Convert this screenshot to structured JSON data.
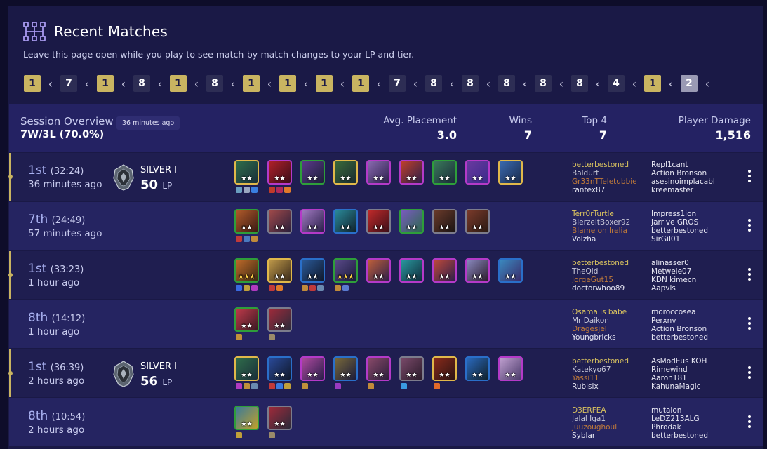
{
  "header": {
    "title": "Recent Matches",
    "subtitle": "Leave this page open while you play to see match-by-match changes to your LP and tier.",
    "icon": "hierarchy-icon"
  },
  "placement_strip": {
    "arrow": "‹",
    "items": [
      {
        "value": "1",
        "style": "gold"
      },
      {
        "value": "7",
        "style": "dark"
      },
      {
        "value": "1",
        "style": "gold"
      },
      {
        "value": "8",
        "style": "dark"
      },
      {
        "value": "1",
        "style": "gold"
      },
      {
        "value": "8",
        "style": "dark"
      },
      {
        "value": "1",
        "style": "gold"
      },
      {
        "value": "1",
        "style": "gold"
      },
      {
        "value": "1",
        "style": "gold"
      },
      {
        "value": "1",
        "style": "gold"
      },
      {
        "value": "7",
        "style": "dark"
      },
      {
        "value": "8",
        "style": "dark"
      },
      {
        "value": "8",
        "style": "dark"
      },
      {
        "value": "8",
        "style": "dark"
      },
      {
        "value": "8",
        "style": "dark"
      },
      {
        "value": "8",
        "style": "dark"
      },
      {
        "value": "4",
        "style": "dark"
      },
      {
        "value": "1",
        "style": "gold"
      },
      {
        "value": "2",
        "style": "grey"
      }
    ]
  },
  "session": {
    "label": "Session Overview",
    "ago": "36 minutes ago",
    "record": "7W/3L (70.0%)",
    "stats": {
      "avg_label": "Avg. Placement",
      "avg_value": "3.0",
      "wins_label": "Wins",
      "wins_value": "7",
      "top4_label": "Top 4",
      "top4_value": "7",
      "damage_label": "Player Damage",
      "damage_value": "1,516"
    }
  },
  "colors": {
    "win_accent": "#c9b461",
    "background": "#0e0d2a",
    "panel": "#1a1946",
    "session_panel": "#242263",
    "cost_1": "#7c7c8c",
    "cost_2": "#2e9e3a",
    "cost_3": "#2a6fc9",
    "cost_4": "#b43ac8",
    "cost_5": "#e0b84a"
  },
  "matches": [
    {
      "win": true,
      "place": "1st",
      "duration": "(32:24)",
      "ago": "36 minutes ago",
      "rank": {
        "tier": "SILVER I",
        "lp": "50",
        "lp_unit": "LP"
      },
      "units": [
        {
          "cost": 5,
          "stars": "★★",
          "gold": false,
          "colors": [
            "#2f6d4a",
            "#1a2f3a"
          ],
          "items": [
            "#6a9ec0",
            "#9aa7c0",
            "#3a7fe0"
          ]
        },
        {
          "cost": 4,
          "stars": "★★",
          "gold": false,
          "colors": [
            "#b0202a",
            "#3a0e18"
          ],
          "items": [
            "#c03a2a",
            "#b02a5a",
            "#e07a2a"
          ]
        },
        {
          "cost": 2,
          "stars": "★★",
          "gold": false,
          "colors": [
            "#5a3a8a",
            "#1e1e3a"
          ],
          "items": []
        },
        {
          "cost": 5,
          "stars": "★★",
          "gold": false,
          "colors": [
            "#3a6a3a",
            "#1a2a30"
          ],
          "items": []
        },
        {
          "cost": 4,
          "stars": "★★",
          "gold": false,
          "colors": [
            "#8a6ab0",
            "#2a1e4a"
          ],
          "items": []
        },
        {
          "cost": 4,
          "stars": "★★",
          "gold": false,
          "colors": [
            "#c0402a",
            "#2a1e4a"
          ],
          "items": []
        },
        {
          "cost": 2,
          "stars": "★★",
          "gold": false,
          "colors": [
            "#3a7a5a",
            "#1a2a3a"
          ],
          "items": []
        },
        {
          "cost": 4,
          "stars": "★★",
          "gold": false,
          "colors": [
            "#6a3aa0",
            "#3a2a8a"
          ],
          "items": []
        },
        {
          "cost": 5,
          "stars": "★★",
          "gold": false,
          "colors": [
            "#3a6ab0",
            "#1a2a4a"
          ],
          "items": []
        }
      ],
      "names_left": [
        {
          "name": "betterbestoned",
          "color": "gold"
        },
        {
          "name": "Baldurt",
          "color": "grey"
        },
        {
          "name": "Gr33nTTeletubbie",
          "color": "orange"
        },
        {
          "name": "rantex87",
          "color": "white"
        }
      ],
      "names_right": [
        "Repl1cant",
        "Action Bronson",
        "asesinoimplacabl",
        "kreemaster"
      ]
    },
    {
      "win": false,
      "place": "7th",
      "duration": "(24:49)",
      "ago": "57 minutes ago",
      "units": [
        {
          "cost": 2,
          "stars": "★★",
          "gold": false,
          "colors": [
            "#b05a2a",
            "#3a1a14"
          ],
          "items": [
            "#c03a3a",
            "#4a7ac0",
            "#c08a3a"
          ]
        },
        {
          "cost": 1,
          "stars": "★★",
          "gold": false,
          "colors": [
            "#a04a4a",
            "#2a1e3a"
          ],
          "items": []
        },
        {
          "cost": 4,
          "stars": "★★",
          "gold": false,
          "colors": [
            "#a07ac0",
            "#2a1e4a"
          ],
          "items": []
        },
        {
          "cost": 3,
          "stars": "★★",
          "gold": false,
          "colors": [
            "#2a8a9a",
            "#10202a"
          ],
          "items": []
        },
        {
          "cost": 1,
          "stars": "★★",
          "gold": false,
          "colors": [
            "#c02a2a",
            "#3a0e18"
          ],
          "items": []
        },
        {
          "cost": 2,
          "stars": "★★",
          "gold": false,
          "colors": [
            "#7a5ac0",
            "#2a6a4a"
          ],
          "items": []
        },
        {
          "cost": 1,
          "stars": "★★",
          "gold": false,
          "colors": [
            "#6a3a2a",
            "#1a1414"
          ],
          "items": []
        },
        {
          "cost": 1,
          "stars": "★★",
          "gold": false,
          "colors": [
            "#7a3a2a",
            "#2a1a14"
          ],
          "items": []
        }
      ],
      "names_left": [
        {
          "name": "Terr0rTurtle",
          "color": "gold"
        },
        {
          "name": "BierzeltBoxer92",
          "color": "grey"
        },
        {
          "name": "Blame on Irelia",
          "color": "orange"
        },
        {
          "name": "Volzha",
          "color": "white"
        }
      ],
      "names_right": [
        "Impress1ion",
        "Jarrive GROS",
        "betterbestoned",
        "SirGil01"
      ]
    },
    {
      "win": true,
      "place": "1st",
      "duration": "(33:23)",
      "ago": "1 hour ago",
      "units": [
        {
          "cost": 2,
          "stars": "★★★",
          "gold": true,
          "colors": [
            "#c06a2a",
            "#3a2a14"
          ],
          "items": [
            "#3a6ae0",
            "#c0a03a",
            "#b03ac0"
          ]
        },
        {
          "cost": 5,
          "stars": "★★",
          "gold": false,
          "colors": [
            "#c09a4a",
            "#3a2a1a"
          ],
          "items": [
            "#c03a3a",
            "#e07a2a"
          ]
        },
        {
          "cost": 3,
          "stars": "★★",
          "gold": false,
          "colors": [
            "#2a5a9a",
            "#10182a"
          ],
          "items": [
            "#c08a3a",
            "#c03a3a",
            "#6a8ab0"
          ]
        },
        {
          "cost": 2,
          "stars": "★★★",
          "gold": true,
          "colors": [
            "#5a4a8a",
            "#1a1a3a"
          ],
          "items": [
            "#c08a3a",
            "#5a7ad0"
          ]
        },
        {
          "cost": 4,
          "stars": "★★",
          "gold": false,
          "colors": [
            "#c0603a",
            "#2a1e4a"
          ],
          "items": []
        },
        {
          "cost": 4,
          "stars": "★★",
          "gold": false,
          "colors": [
            "#2a9aa0",
            "#102a3a"
          ],
          "items": []
        },
        {
          "cost": 4,
          "stars": "★★",
          "gold": false,
          "colors": [
            "#c04a3a",
            "#2a1e4a"
          ],
          "items": []
        },
        {
          "cost": 4,
          "stars": "★★",
          "gold": false,
          "colors": [
            "#8a8ac0",
            "#2a1a2a"
          ],
          "items": []
        },
        {
          "cost": 3,
          "stars": "★★",
          "gold": false,
          "colors": [
            "#3a8ac0",
            "#3a2a6a"
          ],
          "items": []
        }
      ],
      "names_left": [
        {
          "name": "betterbestoned",
          "color": "gold"
        },
        {
          "name": "TheQid",
          "color": "grey"
        },
        {
          "name": "JorgeGut15",
          "color": "orange"
        },
        {
          "name": "doctorwhoo89",
          "color": "white"
        }
      ],
      "names_right": [
        "alinasser0",
        "Metwele07",
        "KDN kimecn",
        "Aapvis"
      ]
    },
    {
      "win": false,
      "place": "8th",
      "duration": "(14:12)",
      "ago": "1 hour ago",
      "units": [
        {
          "cost": 2,
          "stars": "★★",
          "gold": false,
          "colors": [
            "#c03a4a",
            "#3a1a24"
          ],
          "items": [
            "#c0903a"
          ]
        },
        {
          "cost": 1,
          "stars": "★★",
          "gold": false,
          "colors": [
            "#a02a3a",
            "#2a2a3a"
          ],
          "items": [
            "#9a8a6a"
          ]
        }
      ],
      "names_left": [
        {
          "name": "Osama is babe",
          "color": "gold"
        },
        {
          "name": "Mr Daikon",
          "color": "grey"
        },
        {
          "name": "Dragesjel",
          "color": "orange"
        },
        {
          "name": "Youngbricks",
          "color": "white"
        }
      ],
      "names_right": [
        "moroccosea",
        "Perxnv",
        "Action Bronson",
        "betterbestoned"
      ]
    },
    {
      "win": true,
      "place": "1st",
      "duration": "(36:39)",
      "ago": "2 hours ago",
      "rank": {
        "tier": "SILVER I",
        "lp": "56",
        "lp_unit": "LP"
      },
      "units": [
        {
          "cost": 5,
          "stars": "★★",
          "gold": false,
          "colors": [
            "#2f6d4a",
            "#1a2f3a"
          ],
          "items": [
            "#b03ac0",
            "#c0903a",
            "#6a8ab0"
          ]
        },
        {
          "cost": 3,
          "stars": "★★",
          "gold": false,
          "colors": [
            "#2a4a9a",
            "#10182a"
          ],
          "items": [
            "#c03a3a",
            "#3a7ae0",
            "#c0a03a"
          ]
        },
        {
          "cost": 4,
          "stars": "★★",
          "gold": false,
          "colors": [
            "#b04aa0",
            "#2a1e4a"
          ],
          "items": [
            "#c0903a"
          ]
        },
        {
          "cost": 3,
          "stars": "★★",
          "gold": false,
          "colors": [
            "#7a6a3a",
            "#1a1a3a"
          ],
          "items": [
            "#9a3ac0"
          ]
        },
        {
          "cost": 4,
          "stars": "★★",
          "gold": false,
          "colors": [
            "#8a4a6a",
            "#2a1e3a"
          ],
          "items": [
            "#c08a3a"
          ]
        },
        {
          "cost": 1,
          "stars": "★★",
          "gold": false,
          "colors": [
            "#7a4a6a",
            "#2a1a2a"
          ],
          "items": [
            "#3a9ae0"
          ]
        },
        {
          "cost": 5,
          "stars": "★★",
          "gold": false,
          "colors": [
            "#8a2a1a",
            "#2a1414"
          ],
          "items": [
            "#e06a2a"
          ]
        },
        {
          "cost": 3,
          "stars": "★★",
          "gold": false,
          "colors": [
            "#2a6ac0",
            "#10202a"
          ],
          "items": []
        },
        {
          "cost": 4,
          "stars": "★★",
          "gold": false,
          "colors": [
            "#c0a0d0",
            "#4a3a6a"
          ],
          "items": []
        }
      ],
      "names_left": [
        {
          "name": "betterbestoned",
          "color": "gold"
        },
        {
          "name": "Katekyo67",
          "color": "grey"
        },
        {
          "name": "Yassi11",
          "color": "orange"
        },
        {
          "name": "Rubisix",
          "color": "white"
        }
      ],
      "names_right": [
        "AsModEus KOH",
        "Rimewind",
        "Aaron181",
        "KahunaMagic"
      ]
    },
    {
      "win": false,
      "place": "8th",
      "duration": "(10:54)",
      "ago": "2 hours ago",
      "units": [
        {
          "cost": 2,
          "stars": "★★",
          "gold": false,
          "colors": [
            "#3a7a9a",
            "#c0a02a"
          ],
          "items": [
            "#c0a03a"
          ]
        },
        {
          "cost": 1,
          "stars": "★★",
          "gold": false,
          "colors": [
            "#a02a3a",
            "#2a2a3a"
          ],
          "items": [
            "#9a8a6a"
          ]
        }
      ],
      "names_left": [
        {
          "name": "D3ERFEA",
          "color": "gold"
        },
        {
          "name": "Jalal Iga1",
          "color": "grey"
        },
        {
          "name": "juuzoughoul",
          "color": "orange"
        },
        {
          "name": "Syblar",
          "color": "white"
        }
      ],
      "names_right": [
        "mutalon",
        "LeDZ213ALG",
        "Phrodak",
        "betterbestoned"
      ]
    }
  ]
}
